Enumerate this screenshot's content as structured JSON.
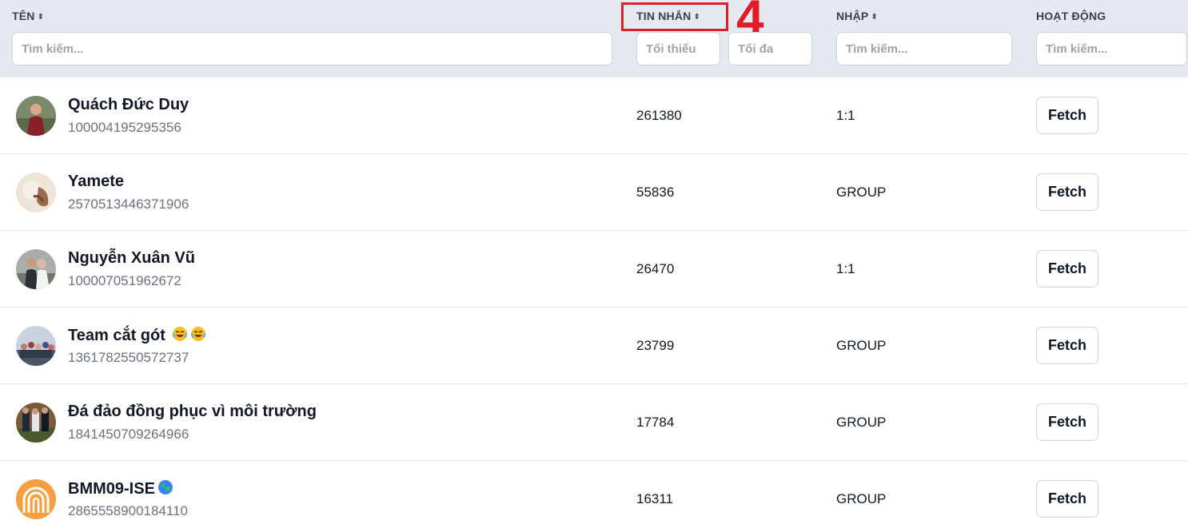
{
  "header": {
    "name_label": "TÊN",
    "messages_label": "TIN NHẮN",
    "type_label": "NHẬP",
    "activity_label": "HOẠT ĐỘNG",
    "sort_glyph": "⬍",
    "annotation": "4"
  },
  "filters": {
    "name_placeholder": "Tìm kiếm...",
    "min_placeholder": "Tối thiểu",
    "max_placeholder": "Tối đa",
    "type_placeholder": "Tìm kiếm...",
    "activity_placeholder": "Tìm kiếm..."
  },
  "colors": {
    "header_bg": "#e5e9f0",
    "annotation": "#e11d2a",
    "muted": "#6b7280"
  },
  "rows": [
    {
      "name": "Quách Đức Duy",
      "id": "100004195295356",
      "messages": "261380",
      "type": "1:1",
      "action": "Fetch",
      "avatar_icon": "person-photo-icon"
    },
    {
      "name": "Yamete",
      "id": "2570513446371906",
      "messages": "55836",
      "type": "GROUP",
      "action": "Fetch",
      "avatar_icon": "group-photo-icon"
    },
    {
      "name": "Nguyễn Xuân Vũ",
      "id": "100007051962672",
      "messages": "26470",
      "type": "1:1",
      "action": "Fetch",
      "avatar_icon": "person-photo-icon"
    },
    {
      "name": "Team cắt gót",
      "id": "1361782550572737",
      "messages": "23799",
      "type": "GROUP",
      "action": "Fetch",
      "avatar_icon": "group-photo-icon",
      "emoji": "laughing-emoji-icon"
    },
    {
      "name": "Đá đảo đồng phục vì môi trường",
      "id": "1841450709264966",
      "messages": "17784",
      "type": "GROUP",
      "action": "Fetch",
      "avatar_icon": "group-photo-icon"
    },
    {
      "name": "BMM09-ISE",
      "id": "2865558900184110",
      "messages": "16311",
      "type": "GROUP",
      "action": "Fetch",
      "avatar_icon": "rainbow-logo-icon",
      "emoji": "globe-emoji-icon"
    }
  ]
}
